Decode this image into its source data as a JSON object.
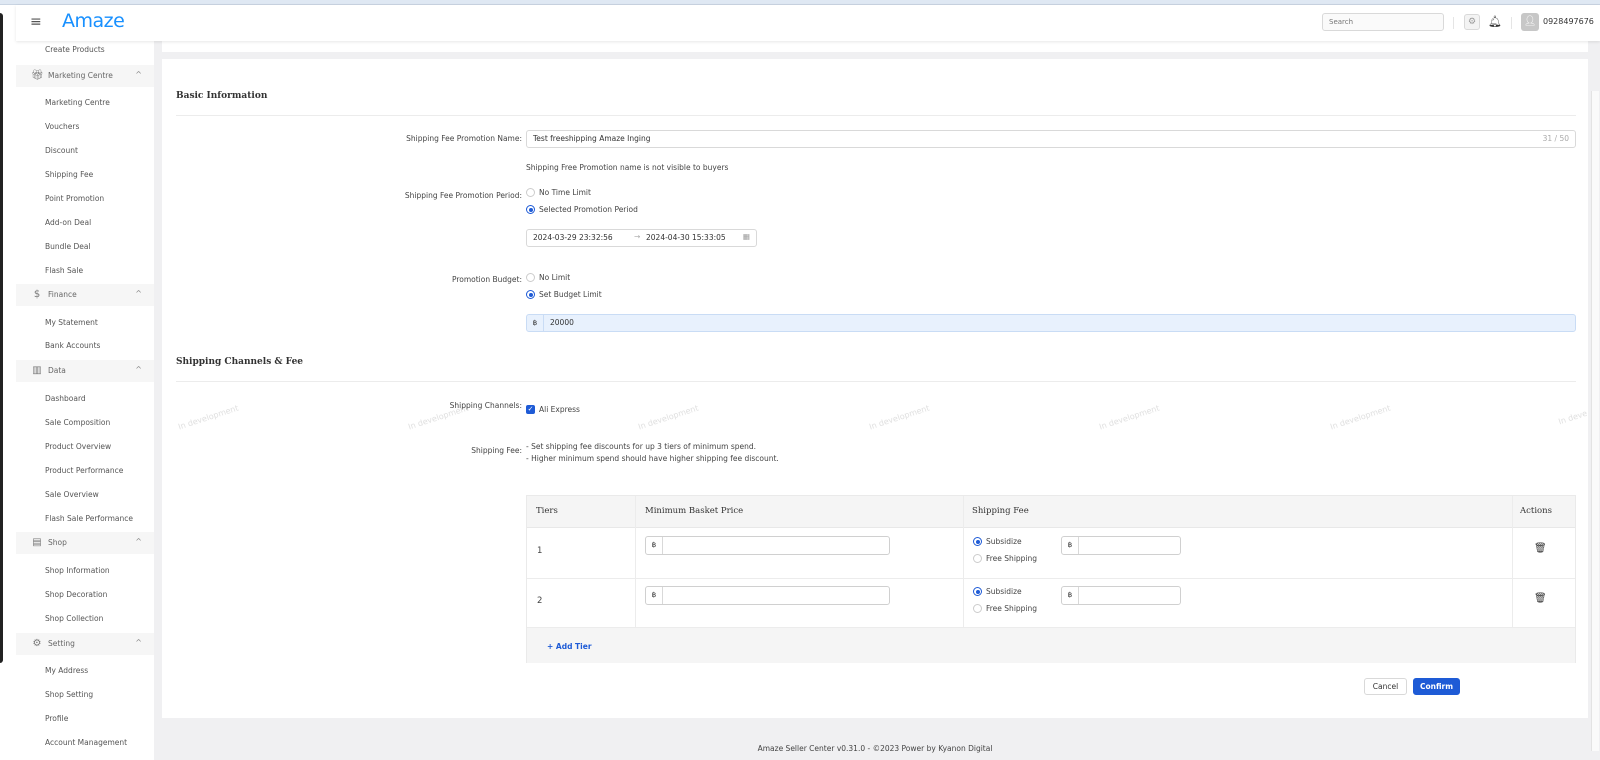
{
  "header": {
    "logo": "Amaze",
    "search_placeholder": "Search",
    "username": "0928497676"
  },
  "sidebar": {
    "top_item": "Create Products",
    "groups": [
      {
        "label": "Marketing Centre",
        "items": [
          "Marketing Centre",
          "Vouchers",
          "Discount",
          "Shipping Fee",
          "Point Promotion",
          "Add-on Deal",
          "Bundle Deal",
          "Flash Sale"
        ]
      },
      {
        "label": "Finance",
        "items": [
          "My Statement",
          "Bank Accounts"
        ]
      },
      {
        "label": "Data",
        "items": [
          "Dashboard",
          "Sale Composition",
          "Product Overview",
          "Product Performance",
          "Sale Overview",
          "Flash Sale Performance"
        ]
      },
      {
        "label": "Shop",
        "items": [
          "Shop Information",
          "Shop Decoration",
          "Shop Collection"
        ]
      },
      {
        "label": "Setting",
        "items": [
          "My Address",
          "Shop Setting",
          "Profile",
          "Account Management"
        ]
      }
    ]
  },
  "basic_info": {
    "title": "Basic Information",
    "name_label": "Shipping Fee Promotion Name",
    "name_value": "Test freeshipping  Amaze Inging",
    "name_counter": "31 / 50",
    "name_hint": "Shipping Free Promotion name is not visible to buyers",
    "period_label": "Shipping Fee Promotion Period",
    "period_options": [
      "No Time Limit",
      "Selected Promotion Period"
    ],
    "period_selected": 1,
    "start_date": "2024-03-29 23:32:56",
    "end_date": "2024-04-30 15:33:05",
    "budget_label": "Promotion Budget",
    "budget_options": [
      "No Limit",
      "Set Budget Limit"
    ],
    "budget_selected": 1,
    "currency": "฿",
    "budget_value": "20000"
  },
  "shipping": {
    "title": "Shipping Channels & Fee",
    "channels_label": "Shipping Channels",
    "channel_name": "Ali Express",
    "channel_checked": true,
    "fee_label": "Shipping Fee",
    "fee_note_1": "- Set shipping fee discounts for up 3 tiers of minimum spend.",
    "fee_note_2": "- Higher minimum spend should have higher shipping fee discount.",
    "watermark": "In development",
    "table": {
      "headers": [
        "Tiers",
        "Minimum Basket Price",
        "Shipping Fee",
        "Actions"
      ],
      "rows": [
        {
          "tier": "1",
          "options": [
            "Subsidize",
            "Free Shipping"
          ],
          "selected": 0
        },
        {
          "tier": "2",
          "options": [
            "Subsidize",
            "Free Shipping"
          ],
          "selected": 0
        }
      ],
      "add_tier": "+ Add Tier"
    }
  },
  "actions": {
    "cancel": "Cancel",
    "confirm": "Confirm"
  },
  "footer": "Amaze Seller Center v0.31.0 - ©2023 Power by Kyanon Digital",
  "colors": {
    "accent": "#1e5bd6",
    "logo": "#1890ff"
  }
}
